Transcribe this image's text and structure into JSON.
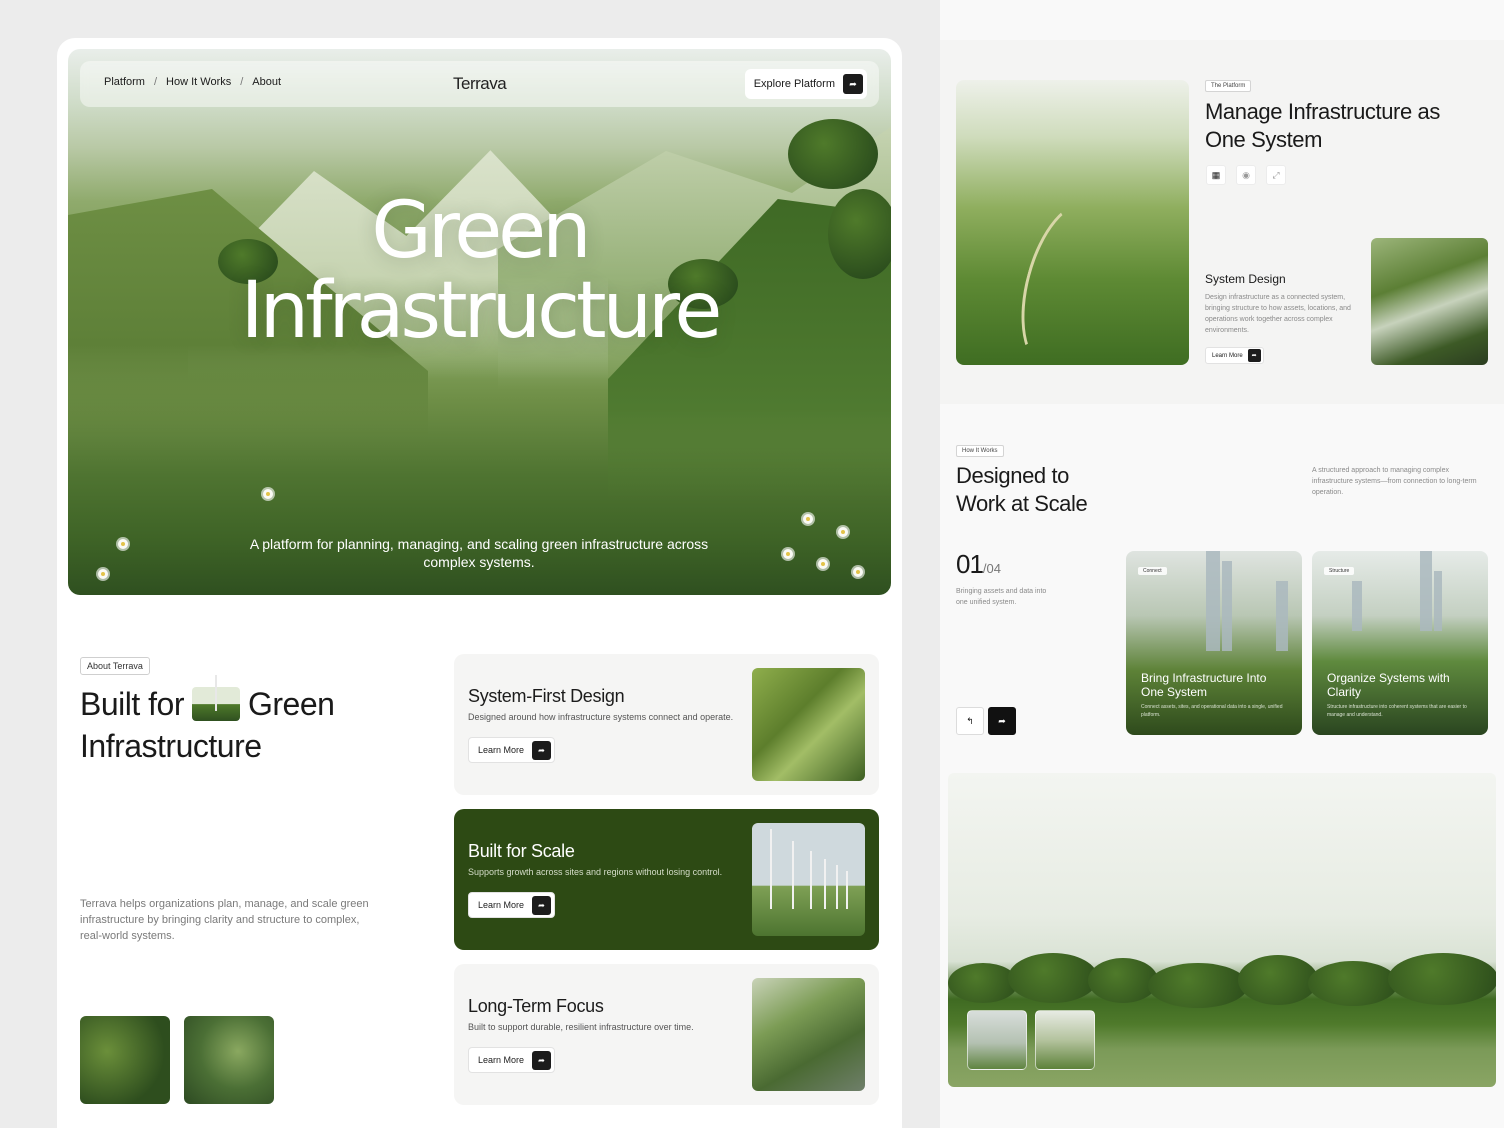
{
  "left": {
    "nav": {
      "links": [
        "Platform",
        "How It Works",
        "About"
      ],
      "brand": "Terrava",
      "cta_label": "Explore Platform",
      "cta_icon": "arrow-icon"
    },
    "hero": {
      "title_line1": "Green",
      "title_line2": "Infrastructure",
      "subtitle": "A platform for planning, managing, and scaling green infrastructure across complex systems."
    },
    "about": {
      "tag": "About Terrava",
      "title_part1": "Built for",
      "title_part2": "Green",
      "title_line2": "Infrastructure",
      "description": "Terrava helps organizations plan, manage, and scale green infrastructure by bringing clarity and structure to complex, real-world systems."
    },
    "features": [
      {
        "title": "System-First Design",
        "description": "Designed around how infrastructure systems connect and operate.",
        "button": "Learn More"
      },
      {
        "title": "Built for Scale",
        "description": "Supports growth across sites and regions without losing control.",
        "button": "Learn More"
      },
      {
        "title": "Long-Term Focus",
        "description": "Built to support durable, resilient infrastructure over time.",
        "button": "Learn More"
      }
    ]
  },
  "right": {
    "platform": {
      "tag": "The Platform",
      "title": "Manage Infrastructure as One System",
      "icons": [
        "grid-icon",
        "eye-icon",
        "expand-icon"
      ],
      "system_design": {
        "title": "System Design",
        "description": "Design infrastructure as a connected system, bringing structure to how assets, locations, and operations work together across complex environments.",
        "button": "Learn More"
      }
    },
    "how_it_works": {
      "tag": "How It Works",
      "title_line1": "Designed to",
      "title_line2": "Work at Scale",
      "description": "A structured approach to managing complex infrastructure systems—from connection to long-term operation.",
      "counter_current": "01",
      "counter_total": "/04",
      "counter_desc": "Bringing assets and data into one unified system.",
      "steps": [
        {
          "tag": "Connect",
          "title": "Bring Infrastructure Into One System",
          "description": "Connect assets, sites, and operational data into a single, unified platform."
        },
        {
          "tag": "Structure",
          "title": "Organize Systems with Clarity",
          "description": "Structure infrastructure into coherent systems that are easier to manage and understand."
        }
      ]
    }
  },
  "colors": {
    "accent_dark_green": "#2d4a14",
    "button_dark": "#1c1c1c",
    "page_bg": "#ececec"
  }
}
